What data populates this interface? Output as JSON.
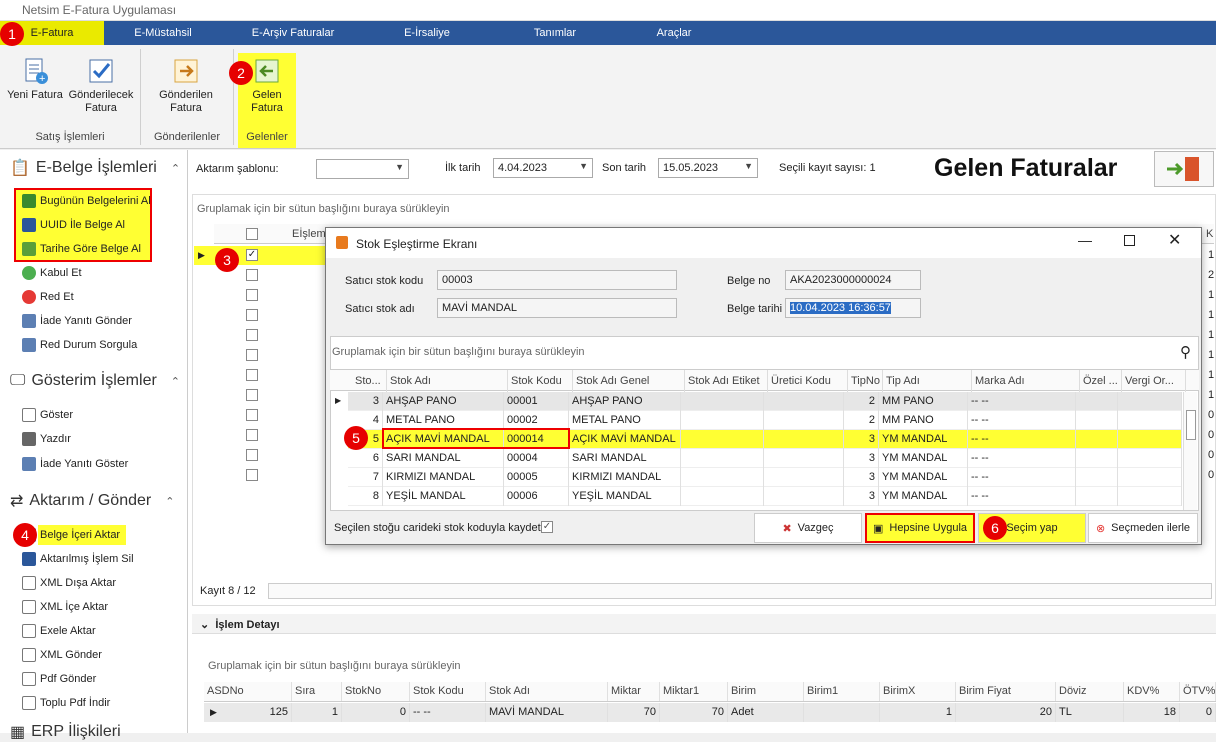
{
  "app": {
    "title": "Netsim E-Fatura Uygulaması"
  },
  "menu": {
    "tabs": [
      "E-Fatura",
      "E-Müstahsil",
      "E-Arşiv Faturalar",
      "E-İrsaliye",
      "Tanımlar",
      "Araçlar"
    ]
  },
  "ribbon": {
    "buttons": {
      "yeni_fatura": "Yeni Fatura",
      "gonderilecek": "Gönderilecek",
      "gonderilecek2": "Fatura",
      "gonderilen": "Gönderilen",
      "gonderilen2": "Fatura",
      "gelen": "Gelen",
      "gelen2": "Fatura"
    },
    "groups": {
      "satis": "Satış İşlemleri",
      "gonderilenler": "Gönderilenler",
      "gelenler": "Gelenler"
    }
  },
  "badges": [
    "1",
    "2",
    "3",
    "4",
    "5",
    "6"
  ],
  "sidebar": {
    "sec1": "E-Belge İşlemleri",
    "sec1_items": [
      "Bugünün Belgelerini Al",
      "UUID İle Belge Al",
      "Tarihe Göre Belge Al",
      "Kabul Et",
      "Red Et",
      "İade Yanıtı Gönder",
      "Red Durum Sorgula"
    ],
    "sec2": "Gösterim İşlemler",
    "sec2_items": [
      "Göster",
      "Yazdır",
      "İade Yanıtı Göster"
    ],
    "sec3": "Aktarım / Gönder",
    "sec3_items": [
      "Belge İçeri Aktar",
      "Aktarılmış İşlem Sil",
      "XML Dışa Aktar",
      "XML İçe Aktar",
      "Exele Aktar",
      "XML Gönder",
      "Pdf Gönder",
      "Toplu Pdf İndir"
    ],
    "sec4": "ERP İlişkileri"
  },
  "filters": {
    "aktarim_label": "Aktarım şablonu:",
    "ilk_tarih_label": "İlk tarih",
    "ilk_tarih": "4.04.2023",
    "son_tarih_label": "Son tarih",
    "son_tarih": "15.05.2023",
    "secili_kayit": "Seçili kayıt sayısı: 1",
    "page_title": "Gelen Faturalar"
  },
  "grid": {
    "group_hint": "Gruplamak için bir sütun başlığını buraya sürükleyin",
    "col_eislem": "Eİşlem",
    "right_col_header": "K",
    "right_values": [
      "1",
      "2",
      "1",
      "1",
      "1",
      "1",
      "1",
      "1",
      "0",
      "0",
      "0",
      "0"
    ],
    "record_count": "Kayıt 8 / 12"
  },
  "dialog": {
    "title": "Stok Eşleştirme Ekranı",
    "satici_stok_kodu_label": "Satıcı stok kodu",
    "satici_stok_kodu": "00003",
    "satici_stok_adi_label": "Satıcı stok adı",
    "satici_stok_adi": "MAVİ MANDAL",
    "belge_no_label": "Belge no",
    "belge_no": "AKA2023000000024",
    "belge_tarihi_label": "Belge tarihi",
    "belge_tarihi": "10.04.2023 16:36:57",
    "group_hint": "Gruplamak için bir sütun başlığını buraya sürükleyin",
    "columns": [
      "Sto...",
      "Stok Adı",
      "Stok Kodu",
      "Stok Adı Genel",
      "Stok Adı Etiket",
      "Üretici Kodu",
      "TipNo",
      "Tip Adı",
      "Marka Adı",
      "Özel ...",
      "Vergi Or..."
    ],
    "rows": [
      {
        "no": "3",
        "ad": "AHŞAP PANO",
        "kod": "00001",
        "genel": "AHŞAP PANO",
        "tip": "2",
        "tipadi": "MM PANO",
        "marka": "-- --"
      },
      {
        "no": "4",
        "ad": "METAL PANO",
        "kod": "00002",
        "genel": "METAL PANO",
        "tip": "2",
        "tipadi": "MM PANO",
        "marka": "-- --"
      },
      {
        "no": "5",
        "ad": "AÇIK MAVİ MANDAL",
        "kod": "000014",
        "genel": "AÇIK MAVİ MANDAL",
        "tip": "3",
        "tipadi": "YM MANDAL",
        "marka": "-- --"
      },
      {
        "no": "6",
        "ad": "SARI MANDAL",
        "kod": "00004",
        "genel": "SARI MANDAL",
        "tip": "3",
        "tipadi": "YM MANDAL",
        "marka": "-- --"
      },
      {
        "no": "7",
        "ad": "KIRMIZI MANDAL",
        "kod": "00005",
        "genel": "KIRMIZI MANDAL",
        "tip": "3",
        "tipadi": "YM MANDAL",
        "marka": "-- --"
      },
      {
        "no": "8",
        "ad": "YEŞİL MANDAL",
        "kod": "00006",
        "genel": "YEŞİL MANDAL",
        "tip": "3",
        "tipadi": "YM MANDAL",
        "marka": "-- --"
      }
    ],
    "save_checkbox_label": "Seçilen stoğu caride­ki stok koduyla kaydet",
    "btn_vazgec": "Vazgeç",
    "btn_hepsine": "Hepsine Uygula",
    "btn_secim": "Seçim yap",
    "btn_secmeden": "Seçmeden ilerle"
  },
  "detail": {
    "title": "İşlem Detayı",
    "group_hint": "Gruplamak için bir sütun başlığını buraya sürükleyin",
    "columns": [
      "ASDNo",
      "Sıra",
      "StokNo",
      "Stok Kodu",
      "Stok Adı",
      "Miktar",
      "Miktar1",
      "Birim",
      "Birim1",
      "BirimX",
      "Birim Fiyat",
      "Döviz",
      "KDV%",
      "ÖTV%"
    ],
    "row": [
      "125",
      "1",
      "0",
      "-- --",
      "MAVİ MANDAL",
      "70",
      "70",
      "Adet",
      "",
      "1",
      "20",
      "TL",
      "18",
      "0"
    ]
  },
  "colors": {
    "accent": "#2b579a",
    "highlight": "#ffff33",
    "badge": "#e60000"
  }
}
